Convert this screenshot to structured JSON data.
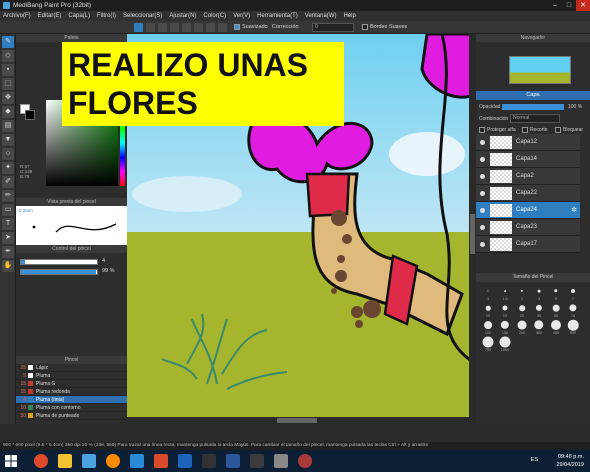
{
  "window": {
    "title": "MediBang Paint Pro (32bit)"
  },
  "menu": [
    "Archivo(F)",
    "Editar(E)",
    "Capa(L)",
    "Filtro(I)",
    "Seleccionar(S)",
    "Ajustar(N)",
    "Color(C)",
    "Ver(V)",
    "Herramienta(T)",
    "Ventana(W)",
    "Help"
  ],
  "toolbar": {
    "antialias_label": "Suavizado",
    "correction_label": "Corrección",
    "correction_value": "0",
    "border_label": "Bordes Suaves"
  },
  "left_panel": {
    "palette_header": "Paleta",
    "rgb_readout": [
      "R:57",
      "G:138",
      "B:79"
    ],
    "preview_header": "Vista previa del pincel",
    "preview_size": "0.2mm",
    "control_header": "Control del pincel",
    "size_value": "4",
    "size_fraction": 0.05,
    "opacity_value": "99 %",
    "opacity_fraction": 0.99,
    "brush_header": "Pincel",
    "brushes": [
      {
        "num": "25",
        "name": "Lápiz",
        "color": "#ffffff"
      },
      {
        "num": "5",
        "name": "Pluma",
        "color": "#ffffff"
      },
      {
        "num": "15",
        "name": "Pluma G",
        "color": "#c0392b"
      },
      {
        "num": "15",
        "name": "Pluma redonda",
        "color": "#c0392b"
      },
      {
        "num": "4",
        "name": "Pluma (tinta)",
        "color": "#2f7fc0",
        "selected": true
      },
      {
        "num": "10",
        "name": "Pluma con contorno",
        "color": "#2e8b57"
      },
      {
        "num": "50",
        "name": "Pluma de punteado",
        "color": "#e0a020"
      }
    ]
  },
  "overlay": {
    "lines": [
      "REALIZO UNAS",
      "FLORES"
    ]
  },
  "right_panel": {
    "navigator_header": "Navegador",
    "layer_header": "Capa",
    "opacity_label": "Opacidad",
    "opacity_value": "100 %",
    "blend_label": "Combinación",
    "blend_value": "Normal",
    "protect_alpha": "Proteger alfa",
    "clip": "Recorte",
    "lock": "Bloquear",
    "layers": [
      {
        "name": "Capa12"
      },
      {
        "name": "Capa14"
      },
      {
        "name": "Capa2"
      },
      {
        "name": "Capa22"
      },
      {
        "name": "Capa24",
        "selected": true
      },
      {
        "name": "Capa23"
      },
      {
        "name": "Capa17"
      }
    ],
    "brushsize_header": "Tamaño del Pincel",
    "brush_sizes": [
      "1",
      "1.5",
      "2",
      "3",
      "5",
      "7",
      "10",
      "15",
      "20",
      "30",
      "50",
      "70",
      "100",
      "150",
      "200",
      "300",
      "400",
      "500",
      "700",
      "1000"
    ]
  },
  "status": {
    "text": "900 * 600 pixel  (9.5 * 6.4cm)  350 dpi  20 %  (338, 559)  Para trazar una línea recta, mantenga pulsada la tecla Mayús. Para cambiar el tamaño del pincel, mantenga pulsada las teclas Ctrl + Alt y arrastre"
  },
  "taskbar": {
    "lang": "ES",
    "time": "09:48 p.m.",
    "date": "29/04/2019"
  }
}
